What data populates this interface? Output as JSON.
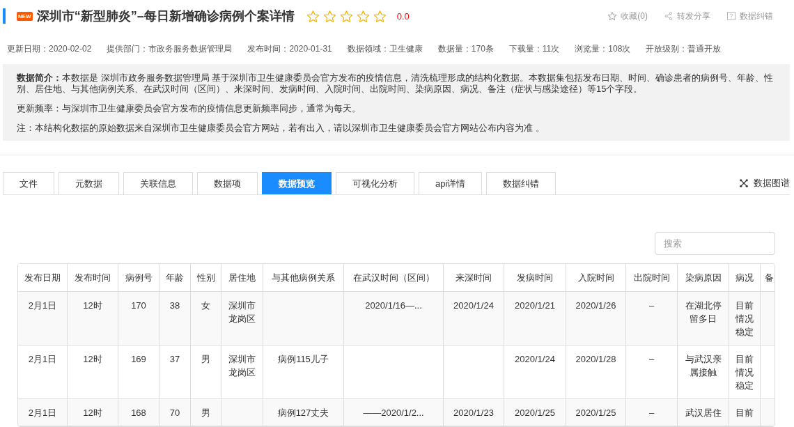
{
  "header": {
    "badge": "NEW",
    "title": "深圳市“新型肺炎”–每日新增确诊病例个案详情",
    "rating": {
      "stars": 0,
      "score": "0.0"
    },
    "actions": [
      {
        "kind": "favorite",
        "label": "收藏(0)"
      },
      {
        "kind": "share",
        "label": "转发分享"
      },
      {
        "kind": "report",
        "label": "数据纠错"
      }
    ]
  },
  "meta": [
    "更新日期：2020-02-02",
    "提供部门：市政务服务数据管理局",
    "发布时间：2020-01-31",
    "数据领域：卫生健康",
    "数据量：170条",
    "下载量：11次",
    "浏览量：108次",
    "开放级别：普通开放"
  ],
  "summary": [
    "**数据简介：**本数据是 深圳市政务服务数据管理局 基于深圳市卫生健康委员会官方发布的疫情信息，清洗梳理形成的结构化数据。本数据集包括发布日期、时间、确诊患者的病例号、年龄、性别、居住地、与其他病例关系、在武汉时间（区间）、来深时间、发病时间、入院时间、出院时间、染病原因、病况、备注（症状与感染途径）等15个字段。",
    "更新频率：与深圳市卫生健康委员会官方发布的疫情信息更新频率同步，通常为每天。",
    "注：本结构化数据的原始数据来自深圳市卫生健康委员会官方网站，若有出入，请以深圳市卫生健康委员会官方网站公布内容为准 。"
  ],
  "tabs": [
    {
      "label": "文件",
      "selected": false
    },
    {
      "label": "元数据",
      "selected": false
    },
    {
      "label": "关联信息",
      "selected": false
    },
    {
      "label": "数据项",
      "selected": false
    },
    {
      "label": "数据预览",
      "selected": true
    },
    {
      "label": "可视化分析",
      "selected": false
    },
    {
      "label": "api详情",
      "selected": false
    },
    {
      "label": "数据纠错",
      "selected": false
    }
  ],
  "graph_link": {
    "label": "数据图谱"
  },
  "search": {
    "placeholder": "搜索"
  },
  "table": {
    "columns": [
      "发布日期",
      "发布时间",
      "病例号",
      "年龄",
      "性别",
      "居住地",
      "与其他病例关系",
      "在武汉时间（区间）",
      "来深时间",
      "发病时间",
      "入院时间",
      "出院时间",
      "染病原因",
      "病况",
      "备"
    ],
    "rows": [
      [
        "2月1日",
        "12时",
        "170",
        "38",
        "女",
        "深圳市龙岗区",
        null,
        "2020/1/16—...",
        "2020/1/24",
        "2020/1/21",
        "2020/1/26",
        "–",
        "在湖北停留多日",
        "目前情况稳定"
      ],
      [
        "2月1日",
        "12时",
        "169",
        "37",
        "男",
        "深圳市龙岗区",
        "病例115儿子",
        null,
        null,
        "2020/1/24",
        "2020/1/28",
        "–",
        "与武汉亲属接触",
        "目前情况稳定"
      ],
      [
        "2月1日",
        "12时",
        "168",
        "70",
        "男",
        null,
        "病例127丈夫",
        "——2020/1/2...",
        "2020/1/23",
        "2020/1/25",
        "2020/1/25",
        "–",
        "武汉居住",
        "目前"
      ]
    ]
  }
}
